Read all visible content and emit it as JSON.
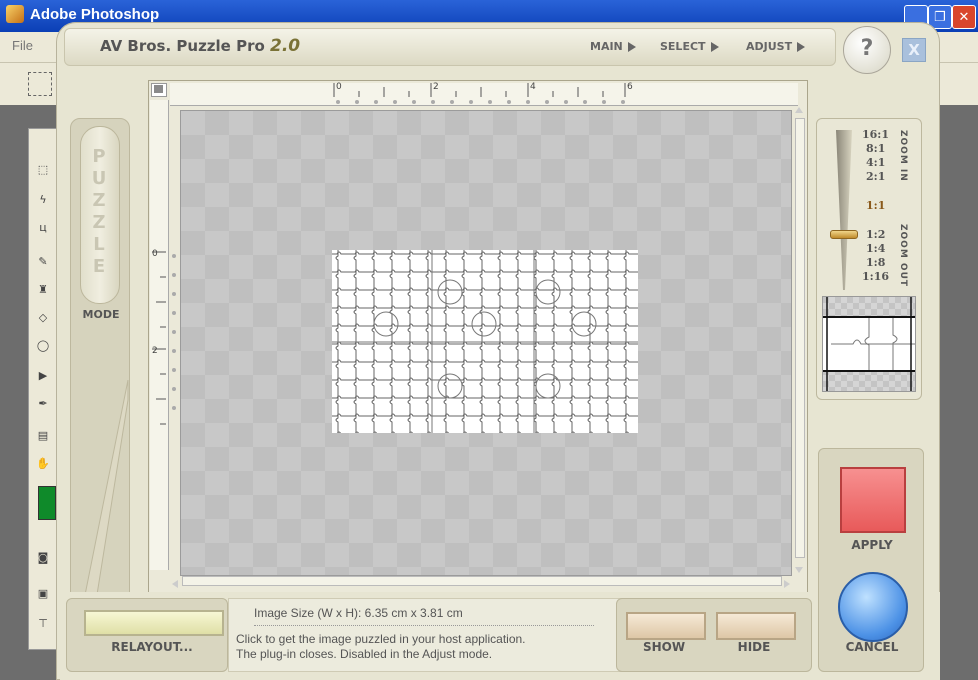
{
  "host": {
    "title": "Adobe Photoshop",
    "menu_file": "File",
    "window_buttons": [
      "_",
      "❐",
      "✕"
    ]
  },
  "plugin": {
    "title": "AV Bros. Puzzle Pro",
    "version": "2.0",
    "nav": [
      {
        "label": "MAIN"
      },
      {
        "label": "SELECT"
      },
      {
        "label": "ADJUST"
      }
    ],
    "help_label": "?",
    "close_label": "X",
    "mode_button_text": "PUZZLE",
    "mode_label": "MODE"
  },
  "rulers": {
    "top_labels": [
      "0",
      "2",
      "4",
      "6"
    ],
    "left_labels": [
      "0",
      "2"
    ]
  },
  "zoom": {
    "in_label": "ZOOM IN",
    "out_label": "ZOOM OUT",
    "levels_in": [
      "16:1",
      "8:1",
      "4:1",
      "2:1"
    ],
    "current": "1:1",
    "levels_out": [
      "1:2",
      "1:4",
      "1:8",
      "1:16"
    ]
  },
  "bottom": {
    "relayout_label": "RELAYOUT...",
    "image_size": "Image Size (W x H): 6.35 cm x 3.81 cm",
    "description_line1": "Click to get the image puzzled in your host application.",
    "description_line2": "The plug-in closes. Disabled in the Adjust mode.",
    "show_label": "SHOW",
    "hide_label": "HIDE",
    "apply_label": "APPLY",
    "cancel_label": "CANCEL"
  },
  "colors": {
    "apply": "#e85a5a",
    "cancel": "#4d92e6",
    "window": "#e7e5d2"
  }
}
